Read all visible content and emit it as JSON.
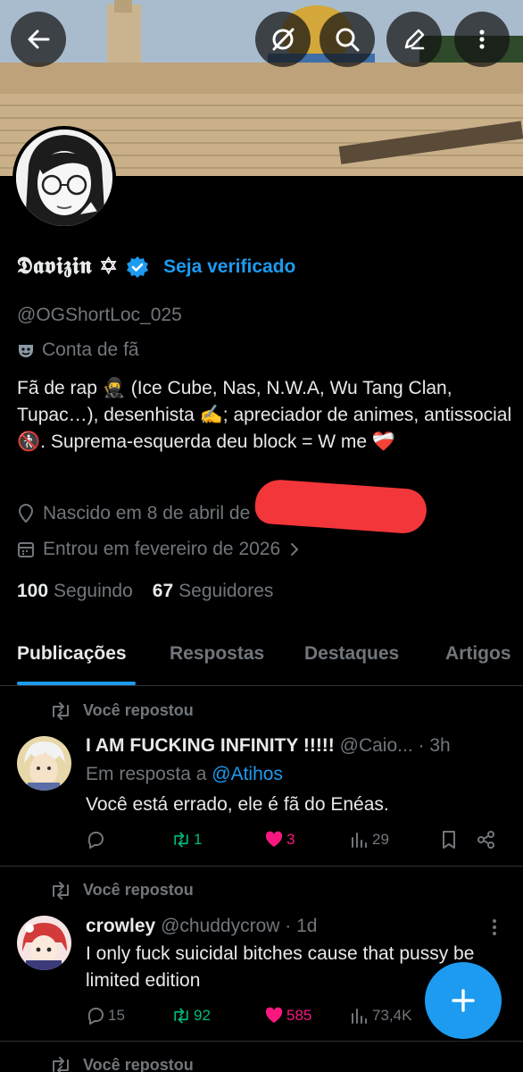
{
  "profile": {
    "display_name": "𝕯𝖆𝖛𝖎𝖟𝖎𝖓 ✡",
    "verify_label": "Seja verificado",
    "handle": "@OGShortLoc_025",
    "category": "Conta de fã",
    "bio": "Fã de rap 🥷 (Ice Cube, Nas, N.W.A, Wu Tang Clan, Tupac…), desenhista ✍️; apreciador de animes, antissocial 🚷. Suprema-esquerda deu block = W me ❤️‍🩹",
    "birth": "Nascido em 8 de abril de",
    "joined": "Entrou em fevereiro de 2026",
    "following_count": "100",
    "following_label": "Seguindo",
    "followers_count": "67",
    "followers_label": "Seguidores"
  },
  "tabs": [
    {
      "label": "Publicações",
      "active": true
    },
    {
      "label": "Respostas",
      "active": false
    },
    {
      "label": "Destaques",
      "active": false
    },
    {
      "label": "Artigos",
      "active": false
    }
  ],
  "posts": [
    {
      "repost_label": "Você repostou",
      "name": "I AM FUCKING INFINITY !!!!!",
      "handle": "@Caio...",
      "time": "· 3h",
      "reply_prefix": "Em resposta a",
      "reply_to": "@Atihos",
      "text": "Você está errado, ele é fã do Enéas.",
      "replies": "",
      "reposts": "1",
      "likes": "3",
      "views": "29"
    },
    {
      "repost_label": "Você repostou",
      "name": "crowley",
      "handle": "@chuddycrow",
      "time": "· 1d",
      "text": "I only fuck suicidal bitches cause that pussy be limited edition",
      "replies": "15",
      "reposts": "92",
      "likes": "585",
      "views": "73,4K"
    },
    {
      "repost_label": "Você repostou"
    }
  ],
  "colors": {
    "accent": "#1d9bf0",
    "repost_green": "#00ba7c",
    "like_pink": "#f91880",
    "muted": "#71767b",
    "text": "#e7e9ea",
    "redaction": "#f3363a"
  },
  "icons": {
    "back": "arrow-left-icon",
    "grok": "grok-icon",
    "search": "search-icon",
    "edit": "edit-pencil-icon",
    "more": "more-vertical-icon",
    "mask": "mask-icon",
    "location": "location-pin-icon",
    "calendar": "calendar-icon",
    "compose": "plus-icon"
  }
}
